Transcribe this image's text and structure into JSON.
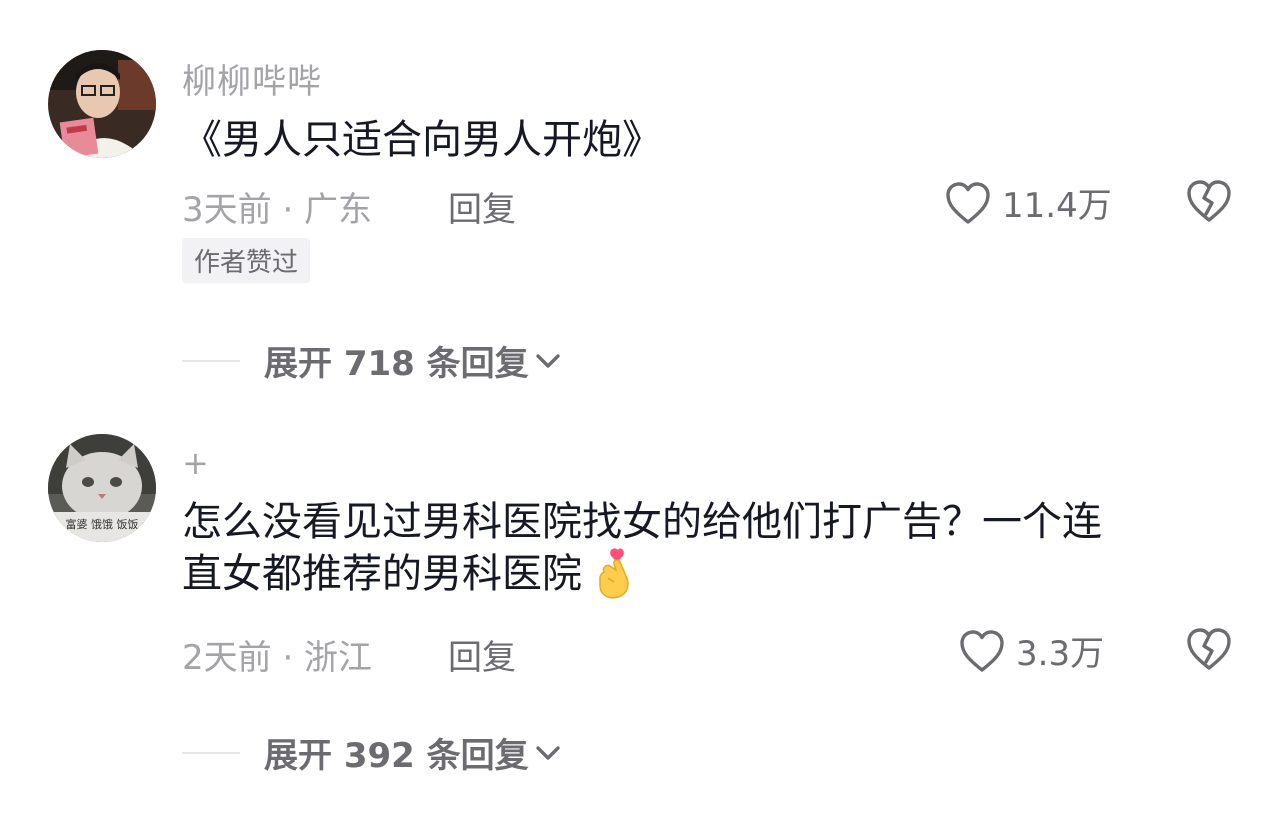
{
  "comments": [
    {
      "username": "柳柳哔哔",
      "content_lines": [
        "《男人只适合向男人开炮》"
      ],
      "time_location": "3天前 · 广东",
      "reply_label": "回复",
      "likes": "11.4万",
      "badge": "作者赞过",
      "expand_label": "展开 718 条回复",
      "avatar_text": ""
    },
    {
      "username": "+",
      "content_lines": [
        "怎么没看见过男科医院找女的给他们打广告？一个连",
        "直女都推荐的男科医院"
      ],
      "emoji": "heart-hands-emoji",
      "time_location": "2天前 · 浙江",
      "reply_label": "回复",
      "likes": "3.3万",
      "expand_label": "展开 392 条回复",
      "avatar_text": "富婆 饿饿 饭饭"
    }
  ],
  "colors": {
    "text_primary": "#161823",
    "text_secondary": "#a3a3a8",
    "text_action": "#6b6b70",
    "badge_bg": "#f2f2f4"
  }
}
